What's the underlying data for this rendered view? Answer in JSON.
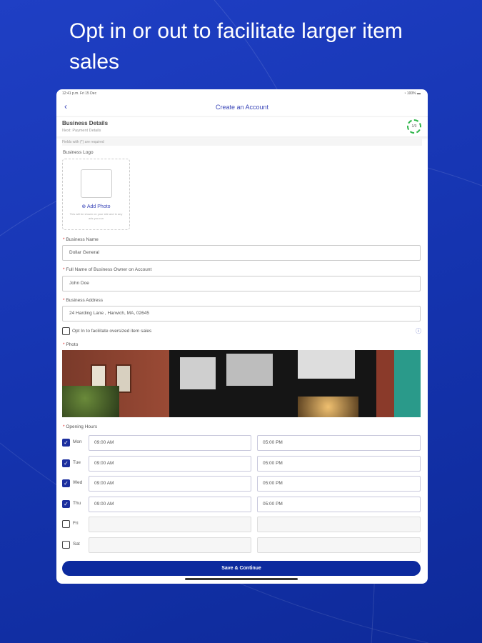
{
  "headline": "Opt in or out to facilitate larger item sales",
  "status": {
    "time": "12:41 p.m.  Fri 15 Dec",
    "battery": "100%"
  },
  "nav": {
    "title": "Create an Account",
    "back": "‹"
  },
  "section": {
    "title": "Business Details",
    "subtitle": "Next: Payment Details",
    "progress": "1/3"
  },
  "required_note": "Fields with (*) are required",
  "logo": {
    "label": "Business Logo",
    "add_photo": "Add Photo",
    "hint": "This will be shown on your site and in any ads you run"
  },
  "fields": [
    {
      "label": "Business Name",
      "value": "Dollar General"
    },
    {
      "label": "Full Name of Business Owner on Account",
      "value": "John Doe"
    },
    {
      "label": "Business Address",
      "value": "24 Harding Lane , Harwich, MA, 02645"
    }
  ],
  "optin": {
    "label": "Opt In to facilitate oversized item sales",
    "checked": false
  },
  "photo_label": "Photo",
  "hours": {
    "label": "Opening Hours",
    "days": [
      {
        "day": "Mon",
        "checked": true,
        "open": "09:00 AM",
        "close": "05:00 PM"
      },
      {
        "day": "Tue",
        "checked": true,
        "open": "09:00 AM",
        "close": "05:00 PM"
      },
      {
        "day": "Wed",
        "checked": true,
        "open": "09:00 AM",
        "close": "05:00 PM"
      },
      {
        "day": "Thu",
        "checked": true,
        "open": "09:00 AM",
        "close": "05:00 PM"
      },
      {
        "day": "Fri",
        "checked": false,
        "open": "",
        "close": ""
      },
      {
        "day": "Sat",
        "checked": false,
        "open": "",
        "close": ""
      }
    ]
  },
  "save_label": "Save & Continue"
}
